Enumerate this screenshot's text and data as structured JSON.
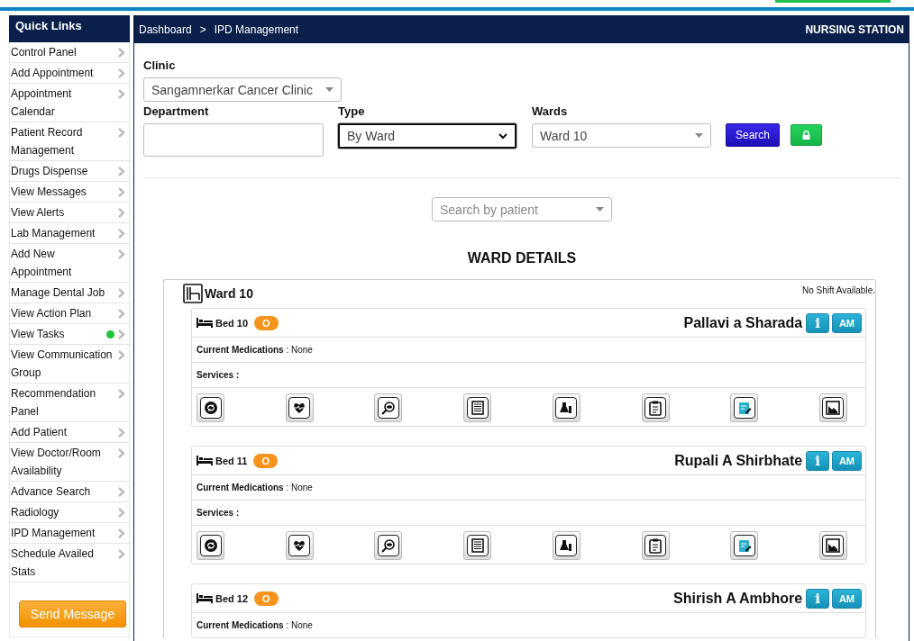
{
  "breadcrumb": {
    "items": [
      "Dashboard",
      "IPD Management"
    ],
    "separator": ">"
  },
  "station": "NURSING STATION",
  "sidebar": {
    "title": "Quick Links",
    "items": [
      {
        "label": "Control Panel",
        "alert": false
      },
      {
        "label": "Add Appointment",
        "alert": false
      },
      {
        "label": "Appointment Calendar",
        "alert": false
      },
      {
        "label": "Patient Record Management",
        "alert": false
      },
      {
        "label": "Drugs Dispense",
        "alert": false
      },
      {
        "label": "View Messages",
        "alert": false
      },
      {
        "label": "View Alerts",
        "alert": false
      },
      {
        "label": "Lab Management",
        "alert": false
      },
      {
        "label": "Add New Appointment",
        "alert": false
      },
      {
        "label": "Manage Dental Job",
        "alert": false
      },
      {
        "label": "View Action Plan",
        "alert": false
      },
      {
        "label": "View Tasks",
        "alert": true
      },
      {
        "label": "View Communication Group",
        "alert": false
      },
      {
        "label": "Recommendation Panel",
        "alert": false
      },
      {
        "label": "Add Patient",
        "alert": false
      },
      {
        "label": "View Doctor/Room Availability",
        "alert": false
      },
      {
        "label": "Advance Search",
        "alert": false
      },
      {
        "label": "Radiology",
        "alert": false
      },
      {
        "label": "IPD Management",
        "alert": false
      },
      {
        "label": "Schedule Availed Stats",
        "alert": false
      }
    ],
    "button": "Send Message"
  },
  "form": {
    "clinic": {
      "label": "Clinic",
      "value": "Sangamnerkar Cancer Clinic"
    },
    "department": {
      "label": "Department"
    },
    "type": {
      "label": "Type",
      "value": "By Ward",
      "focused": true
    },
    "wards": {
      "label": "Wards",
      "value": "Ward 10"
    },
    "search_button": "Search"
  },
  "patient_search": {
    "placeholder": "Search by patient"
  },
  "ward_details": {
    "title": "WARD DETAILS",
    "ward": "Ward 10",
    "shift_note": "No Shift Available.",
    "beds": [
      {
        "bed": "Bed 10",
        "status": "O",
        "patient": "Pallavi a Sharada",
        "info": "i",
        "shift": "AM",
        "medications": "**Current Medications** : None",
        "services_label": "Services :"
      },
      {
        "bed": "Bed 11",
        "status": "O",
        "patient": "Rupali A Shirbhate",
        "info": "i",
        "shift": "AM",
        "medications": "**Current Medications** : None",
        "services_label": "Services :"
      },
      {
        "bed": "Bed 12",
        "status": "O",
        "patient": "Shirish A Ambhore",
        "info": "i",
        "shift": "AM",
        "medications": "**Current Medications** : None"
      }
    ]
  }
}
